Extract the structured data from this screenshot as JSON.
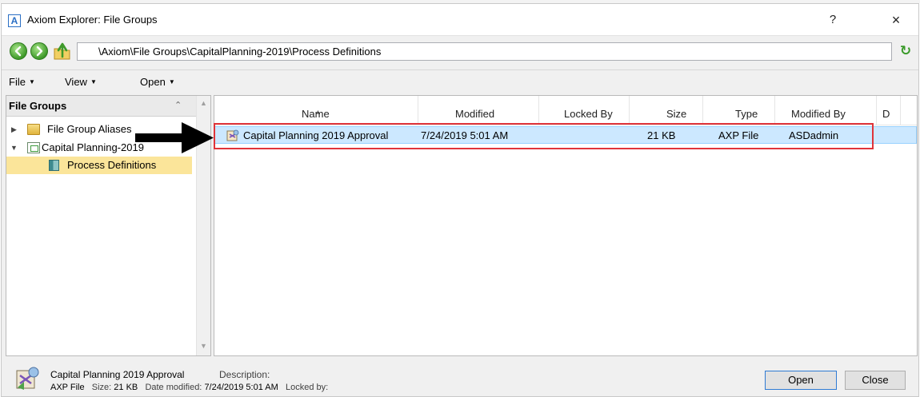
{
  "window": {
    "title": "Axiom Explorer: File Groups",
    "app_icon_letter": "A",
    "help": "?",
    "close": "×"
  },
  "address": {
    "path": "\\Axiom\\File Groups\\CapitalPlanning-2019\\Process Definitions",
    "nav_icons": [
      "back-arrow-icon",
      "forward-arrow-icon",
      "up-folder-icon",
      "refresh-icon"
    ]
  },
  "menu": {
    "items": [
      {
        "label": "File"
      },
      {
        "label": "View"
      },
      {
        "label": "Open"
      }
    ]
  },
  "tree": {
    "header": "File Groups",
    "items": [
      {
        "label": "File Group Aliases",
        "expanded": false,
        "icon": "folder-icon"
      },
      {
        "label": "Capital Planning-2019",
        "expanded": true,
        "icon": "file-group-icon"
      },
      {
        "label": "Process Definitions",
        "selected": true,
        "icon": "book-icon"
      }
    ]
  },
  "list": {
    "columns": [
      "Name",
      "Modified",
      "Locked By",
      "Size",
      "Type",
      "Modified By",
      "D"
    ],
    "rows": [
      {
        "name": "Capital Planning 2019 Approval",
        "modified": "7/24/2019 5:01 AM",
        "locked_by": "",
        "size": "21 KB",
        "type": "AXP File",
        "modified_by": "ASDadmin",
        "selected": true
      }
    ]
  },
  "status": {
    "name": "Capital Planning 2019 Approval",
    "description_label": "Description:",
    "type": "AXP File",
    "size_label": "Size:",
    "size": "21 KB",
    "date_label": "Date modified:",
    "date": "7/24/2019 5:01 AM",
    "locked_label": "Locked by:"
  },
  "buttons": {
    "open": "Open",
    "close": "Close"
  },
  "colors": {
    "selection": "#cce8ff",
    "tree_selection": "#fbe59a",
    "highlight_border": "#e0343a"
  }
}
